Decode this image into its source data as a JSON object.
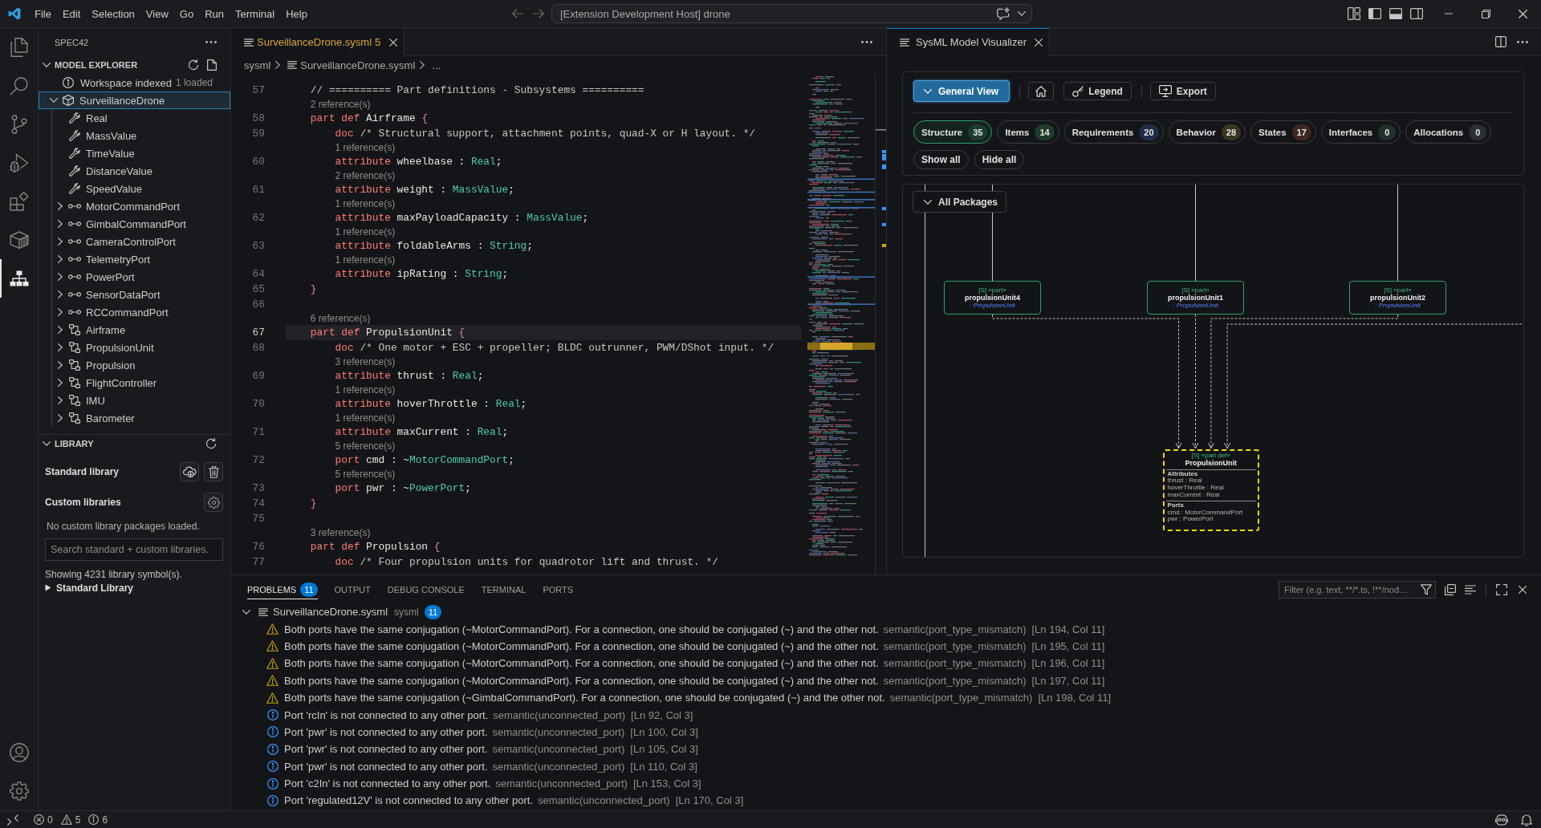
{
  "title_bar": {
    "menu": [
      "File",
      "Edit",
      "Selection",
      "View",
      "Go",
      "Run",
      "Terminal",
      "Help"
    ],
    "command_center": "[Extension Development Host] drone"
  },
  "activity_bar": {
    "top": [
      {
        "kind": "files",
        "selected": false
      },
      {
        "kind": "search",
        "selected": false
      },
      {
        "kind": "source_control",
        "selected": false
      },
      {
        "kind": "run_debug",
        "selected": false
      },
      {
        "kind": "extensions",
        "selected": false
      },
      {
        "kind": "box",
        "selected": false
      },
      {
        "kind": "hierarchy",
        "selected": true
      }
    ],
    "bottom": [
      {
        "kind": "account"
      },
      {
        "kind": "settings"
      }
    ]
  },
  "sidebar": {
    "title": "SPEC42",
    "model_explorer": {
      "title": "MODEL EXPLORER",
      "expanded": true,
      "status": {
        "label": "Workspace indexed",
        "detail": "1 loaded"
      },
      "tree": [
        {
          "label": "SurveillanceDrone",
          "kind": "package",
          "expanded": true,
          "selected": true,
          "children": [
            {
              "label": "Real",
              "kind": "attribute",
              "selected": false
            },
            {
              "label": "MassValue",
              "kind": "attribute",
              "selected": false
            },
            {
              "label": "TimeValue",
              "kind": "attribute",
              "selected": false
            },
            {
              "label": "DistanceValue",
              "kind": "attribute",
              "selected": false
            },
            {
              "label": "SpeedValue",
              "kind": "attribute",
              "selected": false
            },
            {
              "label": "MotorCommandPort",
              "kind": "port",
              "expanded": false,
              "selected": false
            },
            {
              "label": "GimbalCommandPort",
              "kind": "port",
              "expanded": false,
              "selected": false
            },
            {
              "label": "CameraControlPort",
              "kind": "port",
              "expanded": false,
              "selected": false
            },
            {
              "label": "TelemetryPort",
              "kind": "port",
              "expanded": false,
              "selected": false
            },
            {
              "label": "PowerPort",
              "kind": "port",
              "expanded": false,
              "selected": false
            },
            {
              "label": "SensorDataPort",
              "kind": "port",
              "expanded": false,
              "selected": false
            },
            {
              "label": "RCCommandPort",
              "kind": "port",
              "expanded": false,
              "selected": false
            },
            {
              "label": "Airframe",
              "kind": "part",
              "expanded": false,
              "selected": false
            },
            {
              "label": "PropulsionUnit",
              "kind": "part",
              "expanded": false,
              "selected": false
            },
            {
              "label": "Propulsion",
              "kind": "part",
              "expanded": false,
              "selected": false
            },
            {
              "label": "FlightController",
              "kind": "part",
              "expanded": false,
              "selected": false
            },
            {
              "label": "IMU",
              "kind": "part",
              "expanded": false,
              "selected": false
            },
            {
              "label": "Barometer",
              "kind": "part",
              "expanded": false,
              "selected": false
            }
          ]
        }
      ]
    },
    "library": {
      "title": "LIBRARY",
      "expanded": true,
      "standard_label": "Standard library",
      "custom_label": "Custom libraries",
      "empty_message": "No custom library packages loaded.",
      "search": {
        "placeholder": "Search standard + custom libraries."
      },
      "summary": "Showing 4231 library symbol(s).",
      "group": {
        "label": "Standard Library",
        "expanded": false
      }
    }
  },
  "editor": {
    "focused": false,
    "tabs": [
      {
        "label": "SurveillanceDrone.sysml",
        "problems": "5",
        "selected": true
      }
    ],
    "breadcrumb": [
      {
        "label": "sysml",
        "kind": "folder"
      },
      {
        "label": "SurveillanceDrone.sysml",
        "kind": "file"
      },
      {
        "label": "...",
        "kind": "more"
      }
    ],
    "lines": [
      {
        "kind": "code",
        "number": "57",
        "current": false,
        "tokens": [
          {
            "text": "    // ========== Part definitions - Subsystems ==========",
            "kind": "comment"
          }
        ]
      },
      {
        "kind": "lens",
        "text": "2 reference(s)"
      },
      {
        "kind": "code",
        "number": "58",
        "current": false,
        "tokens": [
          {
            "text": "    part def",
            "kind": "keyword"
          },
          {
            "text": " Airframe ",
            "kind": "plain"
          },
          {
            "text": "{",
            "kind": "brace"
          }
        ]
      },
      {
        "kind": "code",
        "number": "59",
        "current": false,
        "tokens": [
          {
            "text": "        doc",
            "kind": "keyword"
          },
          {
            "text": " /* Structural support, attachment points, quad-X or H layout. */",
            "kind": "comment"
          }
        ]
      },
      {
        "kind": "lens",
        "text": "1 reference(s)"
      },
      {
        "kind": "code",
        "number": "60",
        "current": false,
        "tokens": [
          {
            "text": "        attribute",
            "kind": "keyword"
          },
          {
            "text": " wheelbase : ",
            "kind": "plain"
          },
          {
            "text": "Real",
            "kind": "type"
          },
          {
            "text": ";",
            "kind": "plain"
          }
        ]
      },
      {
        "kind": "lens",
        "text": "2 reference(s)"
      },
      {
        "kind": "code",
        "number": "61",
        "current": false,
        "tokens": [
          {
            "text": "        attribute",
            "kind": "keyword"
          },
          {
            "text": " weight : ",
            "kind": "plain"
          },
          {
            "text": "MassValue",
            "kind": "type"
          },
          {
            "text": ";",
            "kind": "plain"
          }
        ]
      },
      {
        "kind": "lens",
        "text": "1 reference(s)"
      },
      {
        "kind": "code",
        "number": "62",
        "current": false,
        "tokens": [
          {
            "text": "        attribute",
            "kind": "keyword"
          },
          {
            "text": " maxPayloadCapacity : ",
            "kind": "plain"
          },
          {
            "text": "MassValue",
            "kind": "type"
          },
          {
            "text": ";",
            "kind": "plain"
          }
        ]
      },
      {
        "kind": "lens",
        "text": "1 reference(s)"
      },
      {
        "kind": "code",
        "number": "63",
        "current": false,
        "tokens": [
          {
            "text": "        attribute",
            "kind": "keyword"
          },
          {
            "text": " foldableArms : ",
            "kind": "plain"
          },
          {
            "text": "String",
            "kind": "type"
          },
          {
            "text": ";",
            "kind": "plain"
          }
        ]
      },
      {
        "kind": "lens",
        "text": "1 reference(s)"
      },
      {
        "kind": "code",
        "number": "64",
        "current": false,
        "tokens": [
          {
            "text": "        attribute",
            "kind": "keyword"
          },
          {
            "text": " ipRating : ",
            "kind": "plain"
          },
          {
            "text": "String",
            "kind": "type"
          },
          {
            "text": ";",
            "kind": "plain"
          }
        ]
      },
      {
        "kind": "code",
        "number": "65",
        "current": false,
        "tokens": [
          {
            "text": "    }",
            "kind": "brace"
          }
        ]
      },
      {
        "kind": "code",
        "number": "66",
        "current": false
      },
      {
        "kind": "lens",
        "text": "6 reference(s)"
      },
      {
        "kind": "code",
        "number": "67",
        "current": true,
        "tokens": [
          {
            "text": "    part def",
            "kind": "keyword"
          },
          {
            "text": " PropulsionUnit ",
            "kind": "plain"
          },
          {
            "text": "{",
            "kind": "brace"
          }
        ]
      },
      {
        "kind": "code",
        "number": "68",
        "current": false,
        "tokens": [
          {
            "text": "        doc",
            "kind": "keyword"
          },
          {
            "text": " /* One motor + ESC + propeller; BLDC outrunner, PWM/DShot input. */",
            "kind": "comment"
          }
        ]
      },
      {
        "kind": "lens",
        "text": "3 reference(s)"
      },
      {
        "kind": "code",
        "number": "69",
        "current": false,
        "tokens": [
          {
            "text": "        attribute",
            "kind": "keyword"
          },
          {
            "text": " thrust : ",
            "kind": "plain"
          },
          {
            "text": "Real",
            "kind": "type"
          },
          {
            "text": ";",
            "kind": "plain"
          }
        ]
      },
      {
        "kind": "lens",
        "text": "1 reference(s)"
      },
      {
        "kind": "code",
        "number": "70",
        "current": false,
        "tokens": [
          {
            "text": "        attribute",
            "kind": "keyword"
          },
          {
            "text": " hoverThrottle : ",
            "kind": "plain"
          },
          {
            "text": "Real",
            "kind": "type"
          },
          {
            "text": ";",
            "kind": "plain"
          }
        ]
      },
      {
        "kind": "lens",
        "text": "1 reference(s)"
      },
      {
        "kind": "code",
        "number": "71",
        "current": false,
        "tokens": [
          {
            "text": "        attribute",
            "kind": "keyword"
          },
          {
            "text": " maxCurrent : ",
            "kind": "plain"
          },
          {
            "text": "Real",
            "kind": "type"
          },
          {
            "text": ";",
            "kind": "plain"
          }
        ]
      },
      {
        "kind": "lens",
        "text": "5 reference(s)"
      },
      {
        "kind": "code",
        "number": "72",
        "current": false,
        "tokens": [
          {
            "text": "        port",
            "kind": "keyword"
          },
          {
            "text": " cmd : ~",
            "kind": "plain"
          },
          {
            "text": "MotorCommandPort",
            "kind": "type"
          },
          {
            "text": ";",
            "kind": "plain"
          }
        ]
      },
      {
        "kind": "lens",
        "text": "5 reference(s)"
      },
      {
        "kind": "code",
        "number": "73",
        "current": false,
        "tokens": [
          {
            "text": "        port",
            "kind": "keyword"
          },
          {
            "text": " pwr : ~",
            "kind": "plain"
          },
          {
            "text": "PowerPort",
            "kind": "type"
          },
          {
            "text": ";",
            "kind": "plain"
          }
        ]
      },
      {
        "kind": "code",
        "number": "74",
        "current": false,
        "tokens": [
          {
            "text": "    }",
            "kind": "brace"
          }
        ]
      },
      {
        "kind": "code",
        "number": "75",
        "current": false
      },
      {
        "kind": "lens",
        "text": "3 reference(s)"
      },
      {
        "kind": "code",
        "number": "76",
        "current": false,
        "tokens": [
          {
            "text": "    part def",
            "kind": "keyword"
          },
          {
            "text": " Propulsion ",
            "kind": "plain"
          },
          {
            "text": "{",
            "kind": "brace"
          }
        ]
      },
      {
        "kind": "code",
        "number": "77",
        "current": false,
        "tokens": [
          {
            "text": "        doc",
            "kind": "keyword"
          },
          {
            "text": " /* Four propulsion units for quadrotor lift and thrust. */",
            "kind": "comment"
          }
        ]
      }
    ]
  },
  "visualizer": {
    "focused": true,
    "tabs": [
      {
        "label": "SysML Model Visualizer",
        "selected": true
      }
    ],
    "toolbar": {
      "view": "General View",
      "buttons": [
        {
          "kind": "home"
        },
        {
          "kind": "legend",
          "label": "Legend"
        },
        {
          "kind": "export",
          "label": "Export"
        }
      ]
    },
    "filters": [
      {
        "label": "Structure",
        "count": "35",
        "color": "#1c3b30",
        "selected": true
      },
      {
        "label": "Items",
        "count": "14",
        "color": "#1f3a2a",
        "selected": false
      },
      {
        "label": "Requirements",
        "count": "20",
        "color": "#1f2e47",
        "selected": false
      },
      {
        "label": "Behavior",
        "count": "28",
        "color": "#3d3420",
        "selected": false
      },
      {
        "label": "States",
        "count": "17",
        "color": "#3f2721",
        "selected": false
      },
      {
        "label": "Interfaces",
        "count": "0",
        "color": "#20332a",
        "selected": false
      },
      {
        "label": "Allocations",
        "count": "0",
        "color": "#2b2e35",
        "selected": false
      }
    ],
    "filter_actions": [
      "Show all",
      "Hide all"
    ],
    "diagram": {
      "scope": "All Packages",
      "parts": [
        {
          "stereotype": "[S] «part»",
          "name": "propulsionUnit4",
          "type": ": PropulsionUnit"
        },
        {
          "stereotype": "[S] «part»",
          "name": "propulsionUnit1",
          "type": ": PropulsionUnit"
        },
        {
          "stereotype": "[S] «part»",
          "name": "propulsionUnit2",
          "type": ": PropulsionUnit"
        }
      ],
      "definition": {
        "stereotype": "[S] «part def»",
        "name": "PropulsionUnit",
        "selected": true,
        "compartments": [
          {
            "title": "Attributes",
            "items": [
              "thrust : Real",
              "hoverThrottle : Real",
              "maxCurrent : Real"
            ]
          },
          {
            "title": "Ports",
            "items": [
              "cmd : MotorCommandPort",
              "pwr : PowerPort"
            ]
          }
        ]
      }
    }
  },
  "panel": {
    "tabs": [
      {
        "label": "PROBLEMS",
        "badge": "11",
        "selected": true
      },
      {
        "label": "OUTPUT",
        "selected": false
      },
      {
        "label": "DEBUG CONSOLE",
        "selected": false
      },
      {
        "label": "TERMINAL",
        "selected": false
      },
      {
        "label": "PORTS",
        "selected": false
      }
    ],
    "filter": {
      "placeholder": "Filter (e.g. text, **/*.ts, !**/nod…"
    },
    "problems": {
      "file": "SurveillanceDrone.sysml",
      "folder": "sysml",
      "count": "11",
      "expanded": true,
      "items": [
        {
          "kind": "warning",
          "message": "Both ports have the same conjugation (~MotorCommandPort). For a connection, one should be conjugated (~) and the other not.",
          "source": "semantic(port_type_mismatch)",
          "location": "[Ln 194, Col 11]"
        },
        {
          "kind": "warning",
          "message": "Both ports have the same conjugation (~MotorCommandPort). For a connection, one should be conjugated (~) and the other not.",
          "source": "semantic(port_type_mismatch)",
          "location": "[Ln 195, Col 11]"
        },
        {
          "kind": "warning",
          "message": "Both ports have the same conjugation (~MotorCommandPort). For a connection, one should be conjugated (~) and the other not.",
          "source": "semantic(port_type_mismatch)",
          "location": "[Ln 196, Col 11]"
        },
        {
          "kind": "warning",
          "message": "Both ports have the same conjugation (~MotorCommandPort). For a connection, one should be conjugated (~) and the other not.",
          "source": "semantic(port_type_mismatch)",
          "location": "[Ln 197, Col 11]"
        },
        {
          "kind": "warning",
          "message": "Both ports have the same conjugation (~GimbalCommandPort). For a connection, one should be conjugated (~) and the other not.",
          "source": "semantic(port_type_mismatch)",
          "location": "[Ln 198, Col 11]"
        },
        {
          "kind": "info",
          "message": "Port 'rcIn' is not connected to any other port.",
          "source": "semantic(unconnected_port)",
          "location": "[Ln 92, Col 3]"
        },
        {
          "kind": "info",
          "message": "Port 'pwr' is not connected to any other port.",
          "source": "semantic(unconnected_port)",
          "location": "[Ln 100, Col 3]"
        },
        {
          "kind": "info",
          "message": "Port 'pwr' is not connected to any other port.",
          "source": "semantic(unconnected_port)",
          "location": "[Ln 105, Col 3]"
        },
        {
          "kind": "info",
          "message": "Port 'pwr' is not connected to any other port.",
          "source": "semantic(unconnected_port)",
          "location": "[Ln 110, Col 3]"
        },
        {
          "kind": "info",
          "message": "Port 'c2In' is not connected to any other port.",
          "source": "semantic(unconnected_port)",
          "location": "[Ln 153, Col 3]"
        },
        {
          "kind": "info",
          "message": "Port 'regulated12V' is not connected to any other port.",
          "source": "semantic(unconnected_port)",
          "location": "[Ln 170, Col 3]"
        }
      ]
    }
  },
  "status_bar": {
    "problems": [
      {
        "kind": "error",
        "count": "0"
      },
      {
        "kind": "warning",
        "count": "5"
      },
      {
        "kind": "info",
        "count": "6"
      }
    ]
  }
}
